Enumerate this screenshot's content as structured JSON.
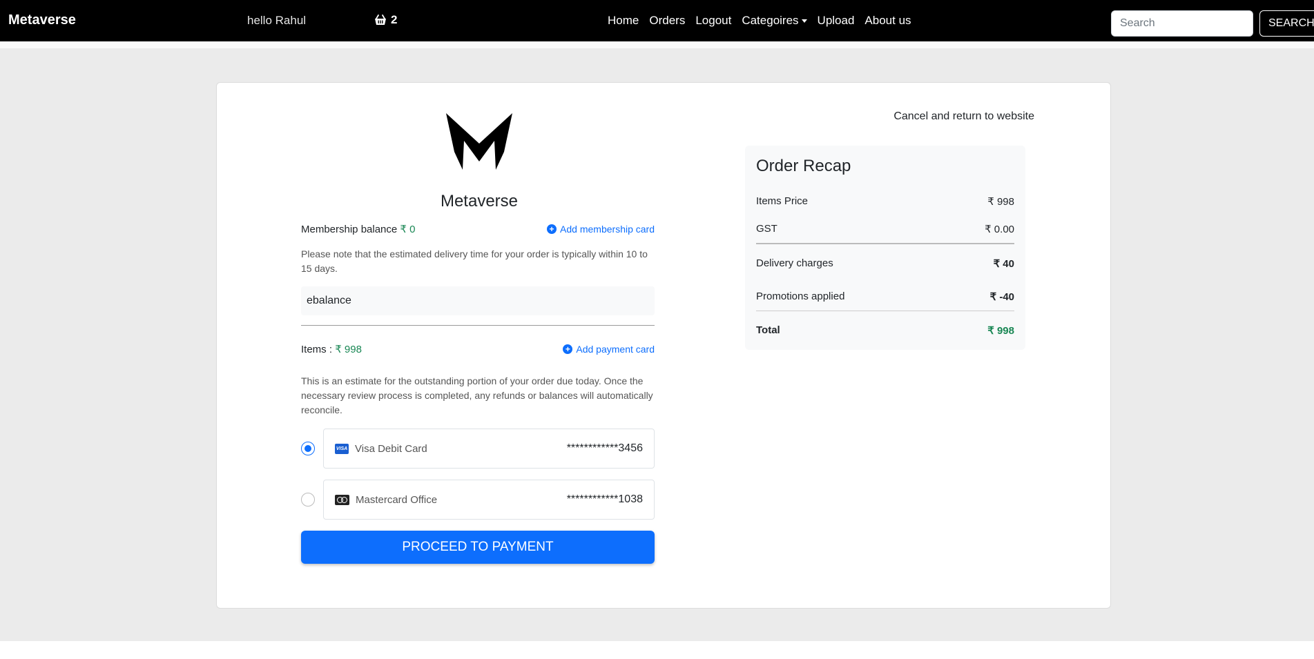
{
  "navbar": {
    "brand": "Metaverse",
    "greeting": "hello Rahul",
    "cart_count": "2",
    "links": [
      "Home",
      "Orders",
      "Logout",
      "Categoires",
      "Upload",
      "About us"
    ],
    "search_placeholder": "Search",
    "search_button": "SEARCH"
  },
  "checkout": {
    "store_name": "Metaverse",
    "membership_label": "Membership balance",
    "membership_value": "₹ 0",
    "add_membership": "Add membership card",
    "delivery_note": "Please note that the estimated delivery time for your order is typically within 10 to 15 days.",
    "payment_method": "ebalance",
    "items_label": "Items :",
    "items_value": "₹ 998",
    "add_payment": "Add payment card",
    "estimate_note": "This is an estimate for the outstanding portion of your order due today. Once the necessary review process is completed, any refunds or balances will automatically reconcile.",
    "cards": [
      {
        "name": "Visa Debit Card",
        "number": "************3456",
        "icon": "visa-icon",
        "selected": true
      },
      {
        "name": "Mastercard Office",
        "number": "************1038",
        "icon": "mastercard-icon",
        "selected": false
      }
    ],
    "proceed_button": "PROCEED TO PAYMENT"
  },
  "recap": {
    "cancel_link": "Cancel and return to website",
    "title": "Order Recap",
    "items_price_label": "Items Price",
    "items_price_value": "₹ 998",
    "gst_label": "GST",
    "gst_value": "₹ 0.00",
    "delivery_label": "Delivery charges",
    "delivery_value": "₹ 40",
    "promo_label": "Promotions applied",
    "promo_value": "₹ -40",
    "total_label": "Total",
    "total_value": "₹ 998"
  },
  "colors": {
    "accent": "#0d6efd",
    "success": "#198754",
    "navbar": "#000000"
  }
}
